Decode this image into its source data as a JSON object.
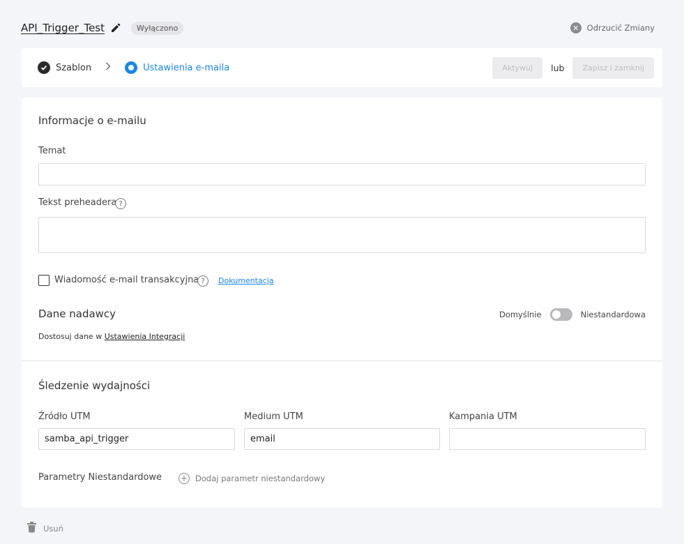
{
  "header": {
    "title": "API_Trigger_Test",
    "status_badge": "Wyłączono",
    "discard_label": "Odrzucić Zmiany"
  },
  "steps": {
    "step1_label": "Szablon",
    "step2_label": "Ustawienia e-maila",
    "activate_label": "Aktywuj",
    "or_label": "lub",
    "save_close_label": "Zapisz i zamknij"
  },
  "email_info": {
    "section_title": "Informacje o e-mailu",
    "subject_label": "Temat",
    "subject_value": "",
    "preheader_label": "Tekst preheadera",
    "preheader_value": "",
    "transactional_label": "Wiadomość e-mail transakcyjna",
    "documentation_link": "Dokumentacja"
  },
  "sender": {
    "section_title": "Dane nadawcy",
    "toggle_left": "Domyślnie",
    "toggle_right": "Niestandardowa",
    "helper_prefix": "Dostosuj dane w",
    "helper_link": "Ustawienia Integracji"
  },
  "tracking": {
    "section_title": "Śledzenie wydajności",
    "utm_source_label": "Źródło UTM",
    "utm_source_value": "samba_api_trigger",
    "utm_medium_label": "Medium UTM",
    "utm_medium_value": "email",
    "utm_campaign_label": "Kampania UTM",
    "utm_campaign_value": "",
    "custom_params_label": "Parametry Niestandardowe",
    "add_param_label": "Dodaj parametr niestandardowy"
  },
  "footer": {
    "delete_label": "Usuń"
  }
}
